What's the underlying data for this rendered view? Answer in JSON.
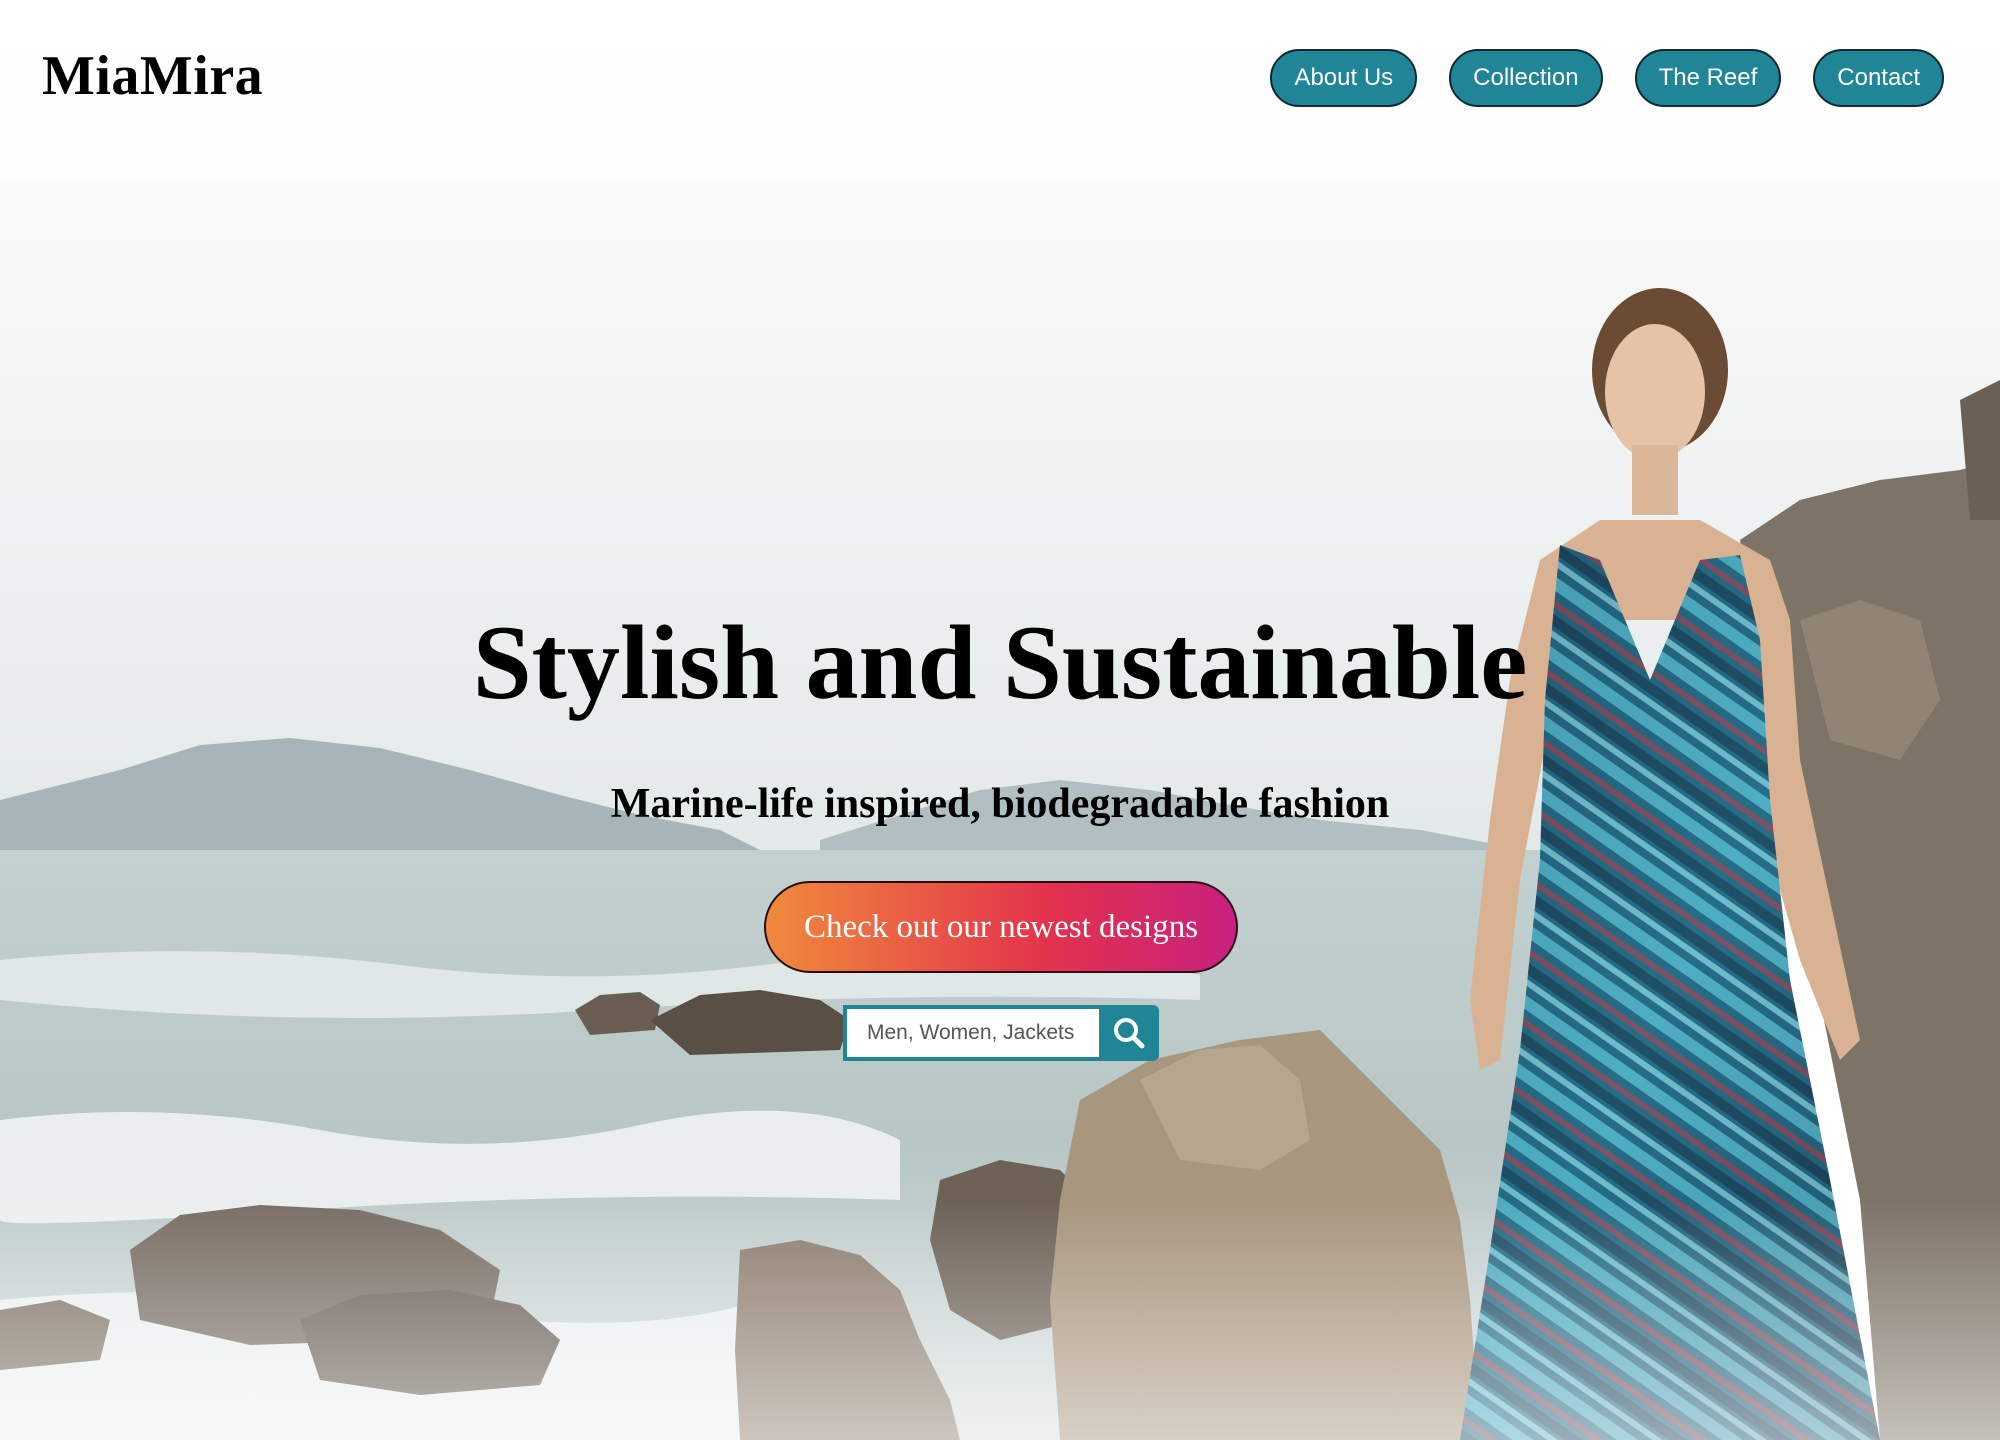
{
  "header": {
    "logo": "MiaMira",
    "nav": [
      {
        "label": "About Us"
      },
      {
        "label": "Collection"
      },
      {
        "label": "The Reef"
      },
      {
        "label": "Contact"
      }
    ]
  },
  "hero": {
    "title": "Stylish and Sustainable",
    "subtitle": "Marine-life inspired, biodegradable fashion",
    "cta_label": "Check out our newest designs",
    "search": {
      "placeholder": "Men, Women, Jackets",
      "button_icon": "search-icon"
    }
  },
  "colors": {
    "accent": "#1f8597",
    "cta_gradient_start": "#ef8a3c",
    "cta_gradient_mid": "#e3324c",
    "cta_gradient_end": "#c8207f"
  }
}
